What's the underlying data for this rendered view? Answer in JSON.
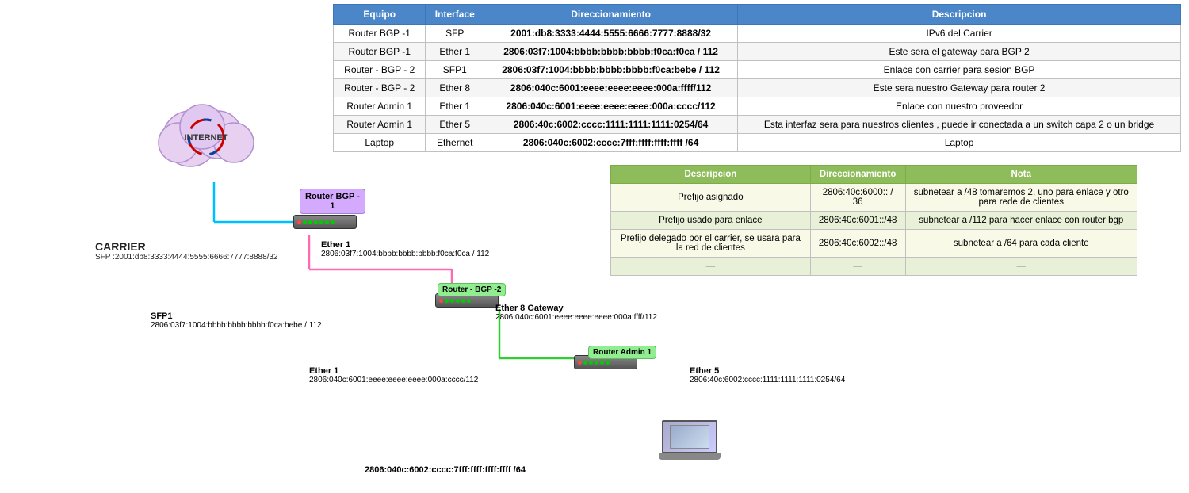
{
  "table": {
    "headers": [
      "Equipo",
      "Interface",
      "Direccionamiento",
      "Descripcion"
    ],
    "rows": [
      [
        "Router BGP -1",
        "SFP",
        "2001:db8:3333:4444:5555:6666:7777:8888/32",
        "IPv6 del Carrier"
      ],
      [
        "Router BGP -1",
        "Ether 1",
        "2806:03f7:1004:bbbb:bbbb:bbbb:f0ca:f0ca / 112",
        "Este sera el gateway para BGP 2"
      ],
      [
        "Router - BGP - 2",
        "SFP1",
        "2806:03f7:1004:bbbb:bbbb:bbbb:f0ca:bebe / 112",
        "Enlace con carrier para sesion BGP"
      ],
      [
        "Router - BGP - 2",
        "Ether 8",
        "2806:040c:6001:eeee:eeee:eeee:000a:ffff/112",
        "Este sera nuestro Gateway para router 2"
      ],
      [
        "Router Admin 1",
        "Ether 1",
        "2806:040c:6001:eeee:eeee:eeee:000a:cccc/112",
        "Enlace con nuestro proveedor"
      ],
      [
        "Router Admin 1",
        "Ether 5",
        "2806:40c:6002:cccc:1111:1111:1111:0254/64",
        "Esta interfaz sera para nuestros clientes , puede ir conectada a un switch capa 2 o un bridge"
      ],
      [
        "Laptop",
        "Ethernet",
        "2806:040c:6002:cccc:7fff:ffff:ffff:ffff /64",
        "Laptop"
      ]
    ]
  },
  "prefix_table": {
    "headers": [
      "Descripcion",
      "Direccionamiento",
      "Nota"
    ],
    "rows": [
      [
        "Prefijo asignado",
        "2806:40c:6000:: / 36",
        "subnetear a /48  tomaremos 2, uno para enlace y otro para rede de clientes"
      ],
      [
        "Prefijo usado para enlace",
        "2806:40c:6001::/48",
        "subnetear a /112 para hacer enlace con router bgp"
      ],
      [
        "Prefijo delegado por el carrier, se usara para la red de clientes",
        "2806:40c:6002::/48",
        "subnetear a /64 para cada cliente"
      ],
      [
        "—",
        "—",
        "—"
      ]
    ]
  },
  "diagram": {
    "internet_label": "INTERNET",
    "carrier_label": "CARRIER",
    "carrier_address": "SFP :2001:db8:3333:4444:5555:6666:7777:8888/32",
    "router_bgp1_label": "Router BGP -\n1",
    "router_bgp1_ether1_label": "Ether 1",
    "router_bgp1_ether1_addr": "2806:03f7:1004:bbbb:bbbb:bbbb:f0ca:f0ca / 112",
    "router_bgp2_label": "Router - BGP -2",
    "router_bgp2_sfp1_label": "SFP1",
    "router_bgp2_sfp1_addr": "2806:03f7:1004:bbbb:bbbb:bbbb:f0ca:bebe / 112",
    "router_bgp2_ether8_label": "Ether 8 Gateway",
    "router_bgp2_ether8_addr": "2806:040c:6001:eeee:eeee:eeee:000a:ffff/112",
    "router_admin1_label": "Router Admin 1",
    "router_admin1_ether1_label": "Ether 1",
    "router_admin1_ether1_addr": "2806:040c:6001:eeee:eeee:eeee:000a:cccc/112",
    "router_admin1_ether5_label": "Ether 5",
    "router_admin1_ether5_addr": "2806:40c:6002:cccc:1111:1111:1111:0254/64",
    "laptop_addr": "2806:040c:6002:cccc:7fff:ffff:ffff:ffff /64",
    "laptop_label": "Laptop"
  }
}
